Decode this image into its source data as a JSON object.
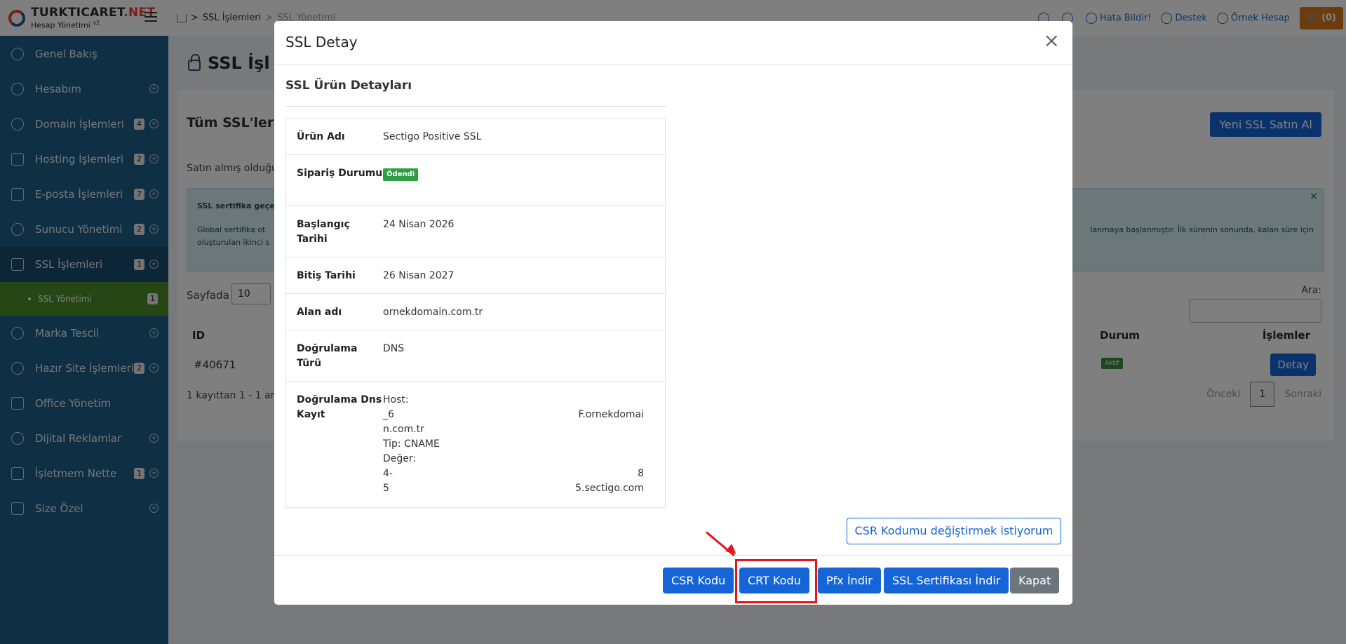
{
  "brand": {
    "name_a": "TURKTICARET",
    "name_sep": ".",
    "name_b": "NET",
    "subtitle": "Hesap Yönetimi",
    "version": "v2"
  },
  "breadcrumb": {
    "level1": "SSL İşlemleri",
    "level2": "SSL Yönetimi"
  },
  "topbar": {
    "report": "Hata Bildir!",
    "support": "Destek",
    "account": "Örnek Hesap",
    "cart": "(0)"
  },
  "sidebar": {
    "items": [
      {
        "label": "Genel Bakış",
        "badge": ""
      },
      {
        "label": "Hesabım",
        "badge": ""
      },
      {
        "label": "Domain İşlemleri",
        "badge": "4"
      },
      {
        "label": "Hosting İşlemleri",
        "badge": "2"
      },
      {
        "label": "E-posta İşlemleri",
        "badge": "7"
      },
      {
        "label": "Sunucu Yönetimi",
        "badge": "2"
      },
      {
        "label": "SSL İşlemleri",
        "badge": "1"
      },
      {
        "label": "Marka Tescil",
        "badge": ""
      },
      {
        "label": "Hazır Site İşlemleri",
        "badge": "2"
      },
      {
        "label": "Office Yönetim",
        "badge": ""
      },
      {
        "label": "Dijital Reklamlar",
        "badge": ""
      },
      {
        "label": "İşletmem Nette",
        "badge": "1"
      },
      {
        "label": "Size Özel",
        "badge": ""
      }
    ],
    "submenu": {
      "label": "SSL Yönetimi",
      "badge": "1"
    }
  },
  "page": {
    "title": "SSL İşl",
    "card_title": "Tüm SSL'ler",
    "new_button": "Yeni SSL Satın Al",
    "desc": "Satın almış olduğu",
    "info_title": "SSL sertifika geçe",
    "info_text1": "Global sertifika ot",
    "info_text2": "oluşturulan ikinci s",
    "info_right": "lanmaya başlanmıştır. İlk sürenin sonunda, kalan süre için",
    "info_close": "×",
    "length_label": "Sayfada",
    "length_value": "10",
    "search_label": "Ara:",
    "columns": {
      "id": "ID",
      "status": "Durum",
      "actions": "İşlemler"
    },
    "row": {
      "id": "#40671",
      "status": "Aktif",
      "action": "Detay"
    },
    "record_info": "1 kayıttan 1 - 1 aras",
    "pager": {
      "prev": "Önceki",
      "current": "1",
      "next": "Sonraki"
    }
  },
  "modal": {
    "title": "SSL Detay",
    "close": "×",
    "section_title": "SSL Ürün Detayları",
    "rows": {
      "product_label": "Ürün Adı",
      "product_value": "Sectigo Positive SSL",
      "order_label": "Sipariş Durumu",
      "order_value": "Ödendi",
      "start_label": "Başlangıç Tarihi",
      "start_value": "24 Nisan 2026",
      "end_label": "Bitiş Tarihi",
      "end_value": "26 Nisan 2027",
      "domain_label": "Alan adı",
      "domain_value": "ornekdomain.com.tr",
      "validation_label": "Doğrulama Türü",
      "validation_value": "DNS",
      "dns_label": "Doğrulama Dns Kayıt",
      "dns": {
        "host_label": "Host:",
        "host_start": "_6",
        "host_end": "F.ornekdomai",
        "host_cont": "n.com.tr",
        "type": "Tip: CNAME",
        "value_label": "Değer:",
        "value_start": "4-",
        "value_end": "8",
        "value2_start": "5",
        "value2_end": "5.sectigo.com"
      }
    },
    "csr_change": "CSR Kodumu değiştirmek istiyorum",
    "buttons": {
      "csr": "CSR Kodu",
      "crt": "CRT Kodu",
      "pfx": "Pfx İndir",
      "ssl_download": "SSL Sertifikası İndir",
      "close": "Kapat"
    }
  },
  "colors": {
    "sidebar": "#1f5f8b",
    "primary": "#1565d8",
    "success": "#2e9e44",
    "highlight": "#e8141b",
    "cart": "#d9781e"
  }
}
